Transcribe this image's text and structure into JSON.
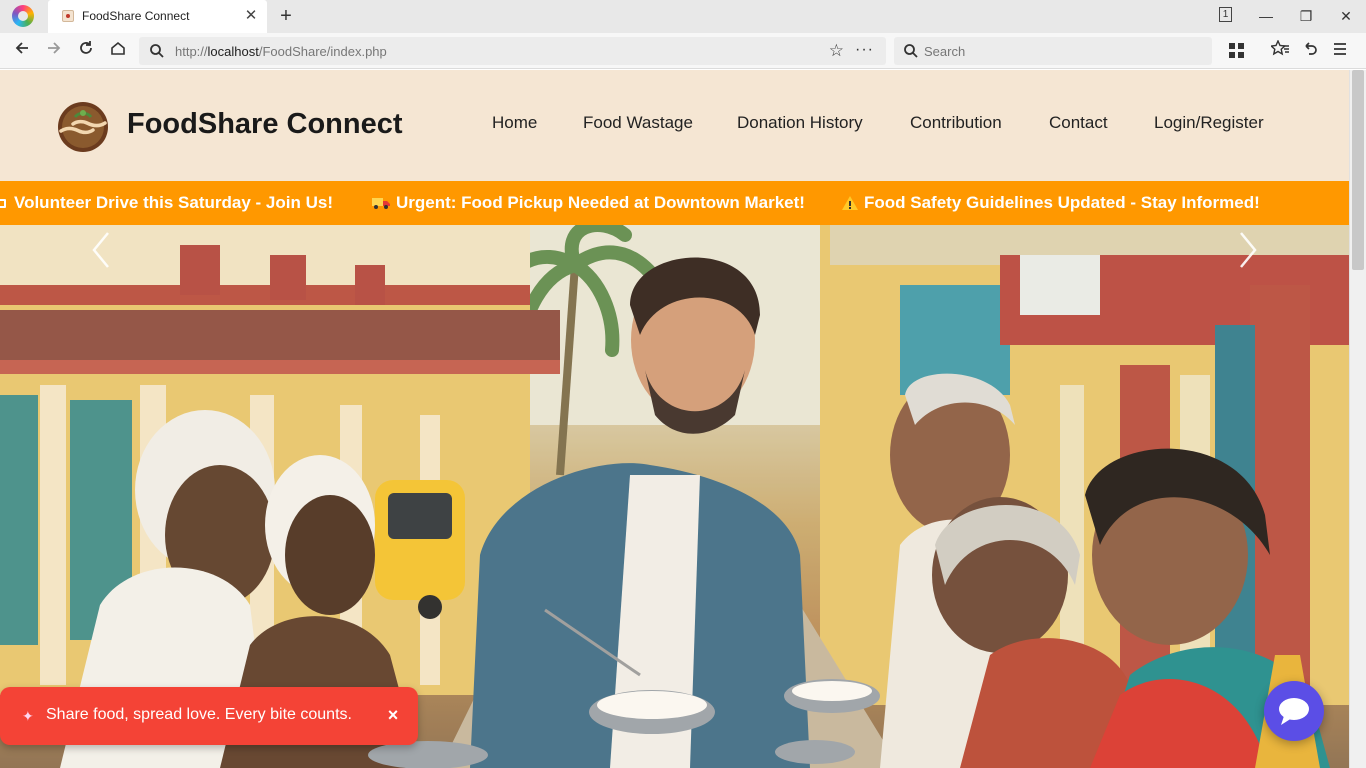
{
  "browser": {
    "tab_title": "FoodShare Connect",
    "new_tab_label": "+",
    "tab_count": "1",
    "url_host": "localhost",
    "url_prefix": "http://",
    "url_path": "/FoodShare/index.php",
    "search_placeholder": "Search"
  },
  "site": {
    "name": "FoodShare Connect",
    "menu": [
      "Home",
      "Food Wastage",
      "Donation History",
      "Contribution",
      "Contact",
      "Login/Register"
    ]
  },
  "ticker": [
    {
      "icon": "volunteer-icon",
      "text": "Volunteer Drive this Saturday - Join Us!"
    },
    {
      "icon": "truck-icon",
      "text": "Urgent: Food Pickup Needed at Downtown Market!"
    },
    {
      "icon": "warning-icon",
      "text": "Food Safety Guidelines Updated - Stay Informed!"
    }
  ],
  "toast": {
    "text": "Share food, spread love. Every bite counts.",
    "close": "×"
  },
  "colors": {
    "header_bg": "#f5e6d3",
    "ticker_bg": "#ff9800",
    "toast_bg": "#f44336",
    "chat_bg": "#5b4ee6"
  }
}
